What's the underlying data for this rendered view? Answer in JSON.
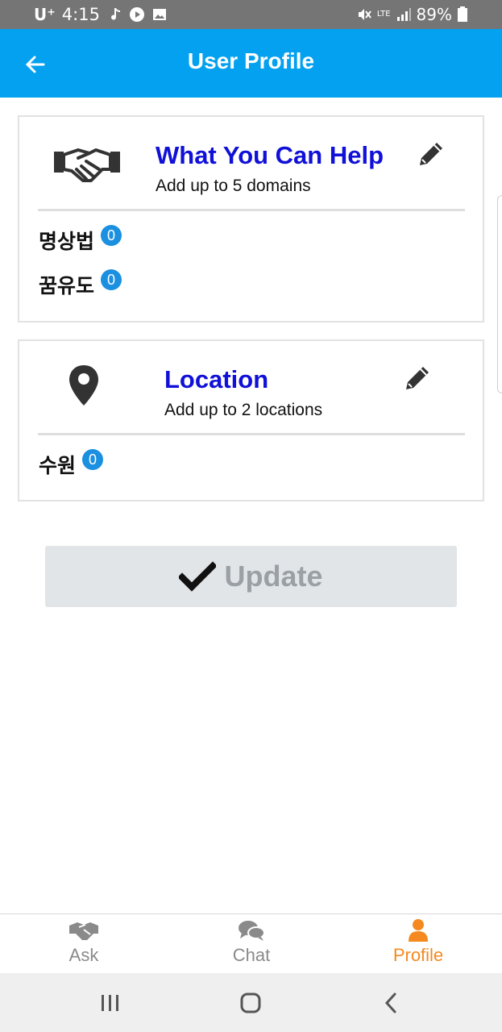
{
  "status_bar": {
    "carrier": "U⁺",
    "time": "4:15",
    "network": "LTE",
    "battery": "89%"
  },
  "header": {
    "title": "User Profile",
    "back_icon": "arrow-left-icon"
  },
  "help_card": {
    "icon": "handshake-icon",
    "title": "What You Can Help",
    "subtitle": "Add up to 5 domains",
    "edit_icon": "pencil-icon",
    "items": [
      {
        "label": "명상법",
        "count": "0"
      },
      {
        "label": "꿈유도",
        "count": "0"
      }
    ]
  },
  "location_card": {
    "icon": "map-marker-icon",
    "title": "Location",
    "subtitle": "Add up to 2 locations",
    "edit_icon": "pencil-icon",
    "items": [
      {
        "label": "수원",
        "count": "0"
      }
    ]
  },
  "update_button": {
    "label": "Update",
    "icon": "checkmark-icon"
  },
  "bottom_nav": {
    "items": [
      {
        "label": "Ask",
        "icon": "handshake-icon"
      },
      {
        "label": "Chat",
        "icon": "chat-bubbles-icon"
      },
      {
        "label": "Profile",
        "icon": "user-icon"
      }
    ],
    "active": "Profile"
  },
  "colors": {
    "header_bg": "#03a1ef",
    "title_blue": "#1010d8",
    "badge_blue": "#1b8fe0",
    "active_orange": "#f5891f"
  }
}
